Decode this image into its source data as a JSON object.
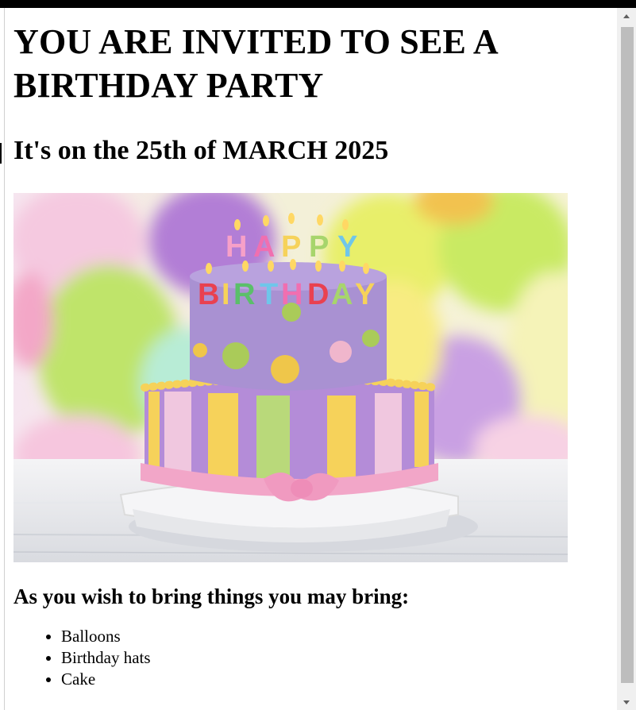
{
  "page": {
    "heading": "YOU ARE INVITED TO SEE A BIRTHDAY PARTY",
    "date_line": "It's on the 25th of MARCH 2025",
    "bring_heading": "As you wish to bring things you may bring:",
    "bring_items": [
      "Balloons",
      "Birthday hats",
      "Cake"
    ]
  },
  "image": {
    "candle_text": "HAPPY BIRTHDAY"
  },
  "scrollbar": {
    "up_icon": "chevron-up-icon",
    "down_icon": "chevron-down-icon"
  }
}
